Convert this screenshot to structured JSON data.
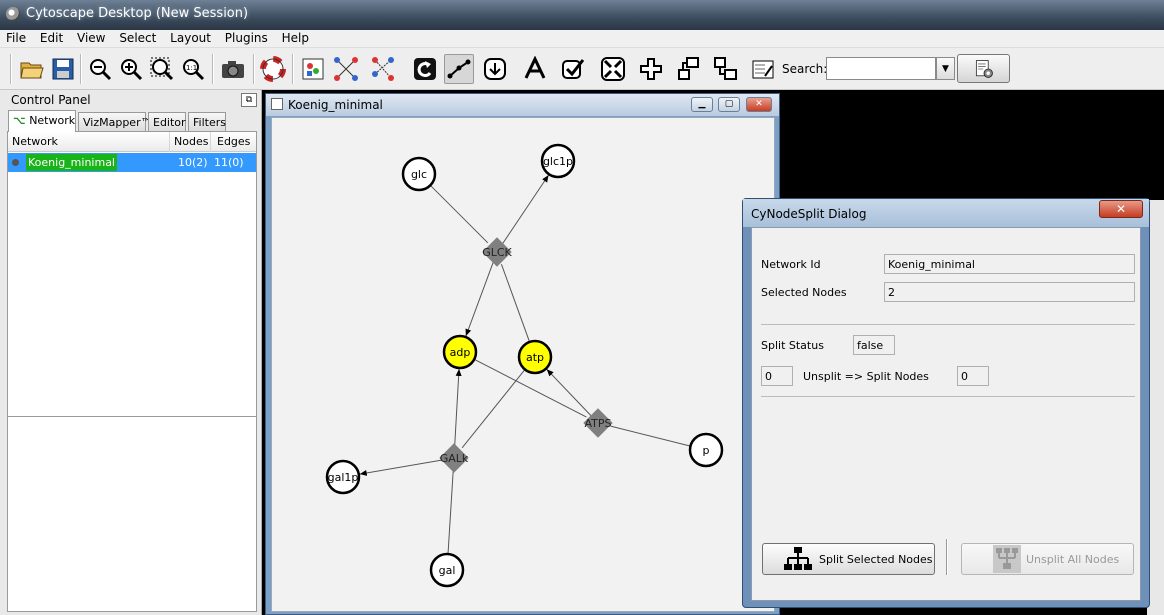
{
  "window": {
    "title": "Cytoscape Desktop (New Session)"
  },
  "menu": [
    "File",
    "Edit",
    "View",
    "Select",
    "Layout",
    "Plugins",
    "Help"
  ],
  "toolbar": {
    "search_label": "Search:",
    "search_value": ""
  },
  "control_panel": {
    "title": "Control Panel",
    "tabs": [
      "Network",
      "VizMapper™",
      "Editor",
      "Filters"
    ],
    "table": {
      "headers": [
        "Network",
        "Nodes",
        "Edges"
      ],
      "rows": [
        {
          "name": "Koenig_minimal",
          "nodes": "10(2)",
          "edges": "11(0)"
        }
      ]
    }
  },
  "network_window": {
    "title": "Koenig_minimal",
    "nodes": [
      {
        "label": "glc",
        "shape": "circle",
        "selected": false
      },
      {
        "label": "glc1p",
        "shape": "circle",
        "selected": false
      },
      {
        "label": "GLCK",
        "shape": "diamond",
        "selected": false
      },
      {
        "label": "adp",
        "shape": "circle",
        "selected": true
      },
      {
        "label": "atp",
        "shape": "circle",
        "selected": true
      },
      {
        "label": "ATPS",
        "shape": "diamond",
        "selected": false
      },
      {
        "label": "p",
        "shape": "circle",
        "selected": false
      },
      {
        "label": "GALk",
        "shape": "diamond",
        "selected": false
      },
      {
        "label": "gal1p",
        "shape": "circle",
        "selected": false
      },
      {
        "label": "gal",
        "shape": "circle",
        "selected": false
      }
    ],
    "edges": [
      {
        "from": "glc",
        "to": "GLCK",
        "arrow": false
      },
      {
        "from": "GLCK",
        "to": "glc1p",
        "arrow": true
      },
      {
        "from": "GLCK",
        "to": "adp",
        "arrow": true
      },
      {
        "from": "atp",
        "to": "GLCK",
        "arrow": false
      },
      {
        "from": "adp",
        "to": "ATPS",
        "arrow": false
      },
      {
        "from": "ATPS",
        "to": "atp",
        "arrow": true
      },
      {
        "from": "p",
        "to": "ATPS",
        "arrow": false
      },
      {
        "from": "atp",
        "to": "GALk",
        "arrow": false
      },
      {
        "from": "GALk",
        "to": "adp",
        "arrow": true
      },
      {
        "from": "GALk",
        "to": "gal1p",
        "arrow": true
      },
      {
        "from": "gal",
        "to": "GALk",
        "arrow": false
      }
    ],
    "colors": {
      "selected_fill": "#ffff00",
      "node_fill": "#ffffff",
      "diamond_fill": "#808080",
      "canvas": "#f2f2f2"
    }
  },
  "dialog": {
    "title": "CyNodeSplit Dialog",
    "network_id_label": "Network Id",
    "network_id_value": "Koenig_minimal",
    "selected_nodes_label": "Selected Nodes",
    "selected_nodes_value": "2",
    "split_status_label": "Split Status",
    "split_status_value": "false",
    "unsplit_count": "0",
    "unsplit_split_label": "Unsplit => Split Nodes",
    "split_count": "0",
    "split_button": "Split Selected Nodes",
    "unsplit_button": "Unsplit All Nodes"
  }
}
